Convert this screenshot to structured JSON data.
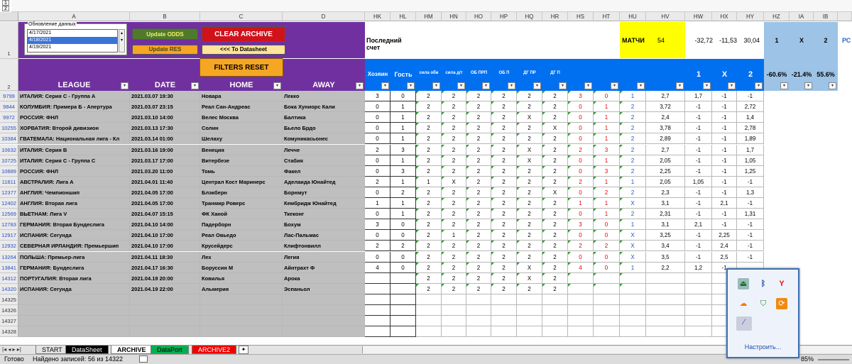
{
  "group_labels": [
    "1",
    "2"
  ],
  "listbox": {
    "title": "Обновление данных",
    "items": [
      "4/17/2021",
      "4/18/2021",
      "4/19/2021"
    ],
    "selected": 1
  },
  "buttons": {
    "update_odds": "Update ODDS",
    "update_res": "Update RES",
    "clear_archive": "CLEAR ARCHIVE",
    "to_datasheet": "<<< To Datasheet",
    "filters_reset": "FILTERS RESET"
  },
  "headers": {
    "league": "LEAGUE",
    "date": "DATE",
    "home": "HOME",
    "away": "AWAY",
    "hk": "Хозяин",
    "hl": "Гость",
    "hm": "сила оби",
    "hn": "сила д/т",
    "ho": "ОБ ПРП",
    "hp": "ОБ П",
    "hq": "ДГ ПР",
    "hr": "ДГ П",
    "hw": "1",
    "hx": "X",
    "hy": "2"
  },
  "top_row": {
    "last_score": "Последний счет",
    "matches": "МАТЧИ",
    "matches_count": "54",
    "hw": "-32,72",
    "hx": "-11,53",
    "hy": "30,04",
    "hz": "1",
    "ia": "X",
    "ib": "2",
    "ic": "РС"
  },
  "row2_pcts": {
    "hz": "-60.6%",
    "ia": "-21.4%",
    "ib": "55.6%"
  },
  "columns": [
    "A",
    "B",
    "C",
    "D",
    "HK",
    "HL",
    "HM",
    "HN",
    "HO",
    "HP",
    "HQ",
    "HR",
    "HS",
    "HT",
    "HU",
    "HV",
    "HW",
    "HX",
    "HY",
    "HZ",
    "IA",
    "IB"
  ],
  "rows": [
    [
      "9799",
      "ИТАЛИЯ: Серия С - Группа А",
      "2021.03.07 19:30",
      "Новара",
      "Лекко",
      "3",
      "0",
      "2",
      "2",
      "2",
      "2",
      "2",
      "2",
      "3",
      "0",
      "1",
      "2,7",
      "1,7",
      "-1",
      "-1"
    ],
    [
      "9844",
      "КОЛУМБИЯ: Примера Б - Апертура",
      "2021.03.07 23:15",
      "Реал Сан-Андреас",
      "Бока Хуниорс Кали",
      "0",
      "1",
      "2",
      "2",
      "2",
      "2",
      "2",
      "2",
      "0",
      "1",
      "2",
      "3,72",
      "-1",
      "-1",
      "2,72"
    ],
    [
      "9972",
      "РОССИЯ: ФНЛ",
      "2021.03.10 14:00",
      "Велес Москва",
      "Балтика",
      "0",
      "1",
      "2",
      "2",
      "2",
      "2",
      "X",
      "2",
      "0",
      "1",
      "2",
      "2,4",
      "-1",
      "-1",
      "1,4"
    ],
    [
      "10255",
      "ХОРВАТИЯ: Второй дивизион",
      "2021.03.13 17:30",
      "Солин",
      "Бьело Брдо",
      "0",
      "1",
      "2",
      "2",
      "2",
      "2",
      "2",
      "X",
      "0",
      "1",
      "2",
      "3,78",
      "-1",
      "-1",
      "2,78"
    ],
    [
      "10384",
      "ГВАТЕМАЛА: Национальная лига - Кл",
      "2021.03.14 01:00",
      "Шелаху",
      "Комуникасьонес",
      "0",
      "1",
      "2",
      "2",
      "2",
      "2",
      "2",
      "2",
      "0",
      "1",
      "2",
      "2,89",
      "-1",
      "-1",
      "1,89"
    ],
    [
      "10632",
      "ИТАЛИЯ: Серия В",
      "2021.03.16 19:00",
      "Венеция",
      "Лечче",
      "2",
      "3",
      "2",
      "2",
      "2",
      "2",
      "X",
      "2",
      "2",
      "3",
      "2",
      "2,7",
      "-1",
      "-1",
      "1,7"
    ],
    [
      "10725",
      "ИТАЛИЯ: Серия С - Группа С",
      "2021.03.17 17:00",
      "Витербезе",
      "Стабия",
      "0",
      "1",
      "2",
      "2",
      "2",
      "2",
      "X",
      "2",
      "0",
      "1",
      "2",
      "2,05",
      "-1",
      "-1",
      "1,05"
    ],
    [
      "10889",
      "РОССИЯ: ФНЛ",
      "2021.03.20 11:00",
      "Томь",
      "Факел",
      "0",
      "3",
      "2",
      "2",
      "2",
      "2",
      "2",
      "2",
      "0",
      "3",
      "2",
      "2,25",
      "-1",
      "-1",
      "1,25"
    ],
    [
      "11811",
      "АВСТРАЛИЯ: Лига А",
      "2021.04.01 11:40",
      "Централ Кост Маринерс",
      "Аделаида Юнайтед",
      "2",
      "1",
      "1",
      "X",
      "2",
      "2",
      "2",
      "2",
      "2",
      "1",
      "1",
      "2,05",
      "1,05",
      "-1",
      "-1"
    ],
    [
      "12377",
      "АНГЛИЯ: Чемпионшип",
      "2021.04.05 17:00",
      "Блэкберн",
      "Борнмут",
      "0",
      "2",
      "2",
      "2",
      "2",
      "2",
      "2",
      "X",
      "0",
      "2",
      "2",
      "2,3",
      "-1",
      "-1",
      "1,3"
    ],
    [
      "12402",
      "АНГЛИЯ: Вторая лига",
      "2021.04.05 17:00",
      "Транмир Роверс",
      "Кембридж Юнайтед",
      "1",
      "1",
      "2",
      "2",
      "2",
      "2",
      "2",
      "2",
      "1",
      "1",
      "X",
      "3,1",
      "-1",
      "2,1",
      "-1"
    ],
    [
      "12569",
      "ВЬЕТНАМ: Лига V",
      "2021.04.07 15:15",
      "ФК Ханой",
      "Ткеконг",
      "0",
      "1",
      "2",
      "2",
      "2",
      "2",
      "2",
      "2",
      "0",
      "1",
      "2",
      "2,31",
      "-1",
      "-1",
      "1,31"
    ],
    [
      "12783",
      "ГЕРМАНИЯ: Вторая Бундеслига",
      "2021.04.10 14:00",
      "Падерборн",
      "Бохум",
      "3",
      "0",
      "2",
      "2",
      "2",
      "2",
      "2",
      "2",
      "3",
      "0",
      "1",
      "3,1",
      "2,1",
      "-1",
      "-1"
    ],
    [
      "12917",
      "ИСПАНИЯ: Сегунда",
      "2021.04.10 17:00",
      "Реал Овьедо",
      "Лас-Пальмас",
      "0",
      "0",
      "2",
      "1",
      "2",
      "2",
      "2",
      "2",
      "0",
      "0",
      "X",
      "3,25",
      "-1",
      "2,25",
      "-1"
    ],
    [
      "12932",
      "СЕВЕРНАЯ ИРЛАНДИЯ: Премьершип",
      "2021.04.10 17:00",
      "Крусейдерс",
      "Клифтонвилл",
      "2",
      "2",
      "2",
      "2",
      "2",
      "2",
      "2",
      "2",
      "2",
      "2",
      "X",
      "3,4",
      "-1",
      "2,4",
      "-1"
    ],
    [
      "13264",
      "ПОЛЬША: Премьер-лига",
      "2021.04.11 18:30",
      "Лех",
      "Легия",
      "0",
      "0",
      "2",
      "2",
      "2",
      "2",
      "2",
      "2",
      "0",
      "0",
      "X",
      "3,5",
      "-1",
      "2,5",
      "-1"
    ],
    [
      "13841",
      "ГЕРМАНИЯ: Бундеслига",
      "2021.04.17 16:30",
      "Боруссия М",
      "Айнтрахт Ф",
      "4",
      "0",
      "2",
      "2",
      "2",
      "2",
      "X",
      "2",
      "4",
      "0",
      "1",
      "2,2",
      "1,2",
      "-1",
      ""
    ],
    [
      "14312",
      "ПОРТУГАЛИЯ: Вторая лига",
      "2021.04.19 20:00",
      "Ковилья",
      "Арока",
      "",
      "",
      "2",
      "2",
      "2",
      "2",
      "X",
      "2",
      "",
      "",
      "",
      "",
      "",
      "",
      ""
    ],
    [
      "14320",
      "ИСПАНИЯ: Сегунда",
      "2021.04.19 22:00",
      "Альмерия",
      "Эспаньол",
      "",
      "",
      "2",
      "2",
      "2",
      "2",
      "2",
      "2",
      "",
      "",
      "",
      "",
      "",
      "",
      ""
    ],
    [
      "14325",
      "",
      "",
      "",
      "",
      "",
      "",
      "",
      "",
      "",
      "",
      "",
      "",
      "",
      "",
      "",
      "",
      "",
      "",
      ""
    ],
    [
      "14326",
      "",
      "",
      "",
      "",
      "",
      "",
      "",
      "",
      "",
      "",
      "",
      "",
      "",
      "",
      "",
      "",
      "",
      "",
      ""
    ],
    [
      "14327",
      "",
      "",
      "",
      "",
      "",
      "",
      "",
      "",
      "",
      "",
      "",
      "",
      "",
      "",
      "",
      "",
      "",
      "",
      ""
    ],
    [
      "14328",
      "",
      "",
      "",
      "",
      "",
      "",
      "",
      "",
      "",
      "",
      "",
      "",
      "",
      "",
      "",
      "",
      "",
      "",
      ""
    ]
  ],
  "tabs": [
    "START",
    "DataSheet",
    "ARCHIVE",
    "DataPort",
    "ARCHIVE2"
  ],
  "status": {
    "ready": "Готово",
    "found": "Найдено записей: 56 из 14322",
    "zoom": "85%"
  },
  "tray": {
    "customize": "Настроить..."
  },
  "colors": {
    "purple": "#7030a0",
    "blue": "#0070f0",
    "yellow": "#ffff00",
    "lightblue": "#9dc3e6",
    "grey": "#bfbfbf"
  }
}
